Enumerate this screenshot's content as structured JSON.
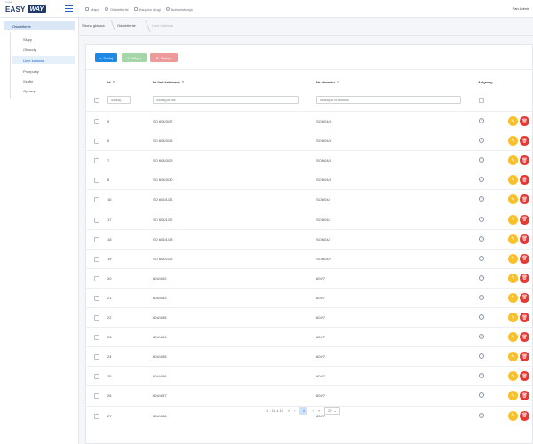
{
  "header": {
    "logo_text": "EASY",
    "logo_badge": "WAY",
    "logo_tagline": "system",
    "nav": [
      {
        "label": "Mapa",
        "icon": "map-icon"
      },
      {
        "label": "Oświetlenie",
        "icon": "lightbulb-icon"
      },
      {
        "label": "Książka drogi",
        "icon": "book-icon"
      },
      {
        "label": "Administracja",
        "icon": "settings-icon"
      }
    ],
    "user": "Pan Admin"
  },
  "sidebar": {
    "section": "Oświetlenie",
    "items": [
      {
        "label": "Słupy"
      },
      {
        "label": "Obwody"
      },
      {
        "label": "Linie kablowe"
      },
      {
        "label": "Przepusty"
      },
      {
        "label": "Szafki"
      },
      {
        "label": "Oprawy"
      }
    ],
    "active_index": 2
  },
  "breadcrumb": [
    "Strona główna",
    "Oświetlenie",
    "Linie kablowe"
  ],
  "toolbar": {
    "add": "Dodaj",
    "enable": "Włącz",
    "disable": "Wyłącz"
  },
  "table": {
    "headers": {
      "id": "Id",
      "cable": "Nr linii kablowej",
      "circuit": "Nr obwodu",
      "active": "Aktywny"
    },
    "filters": {
      "id": "Szukaj...",
      "cable": "Szukaj po linii",
      "circuit": "Szukaj po nr obwodu"
    },
    "rows": [
      {
        "id": "5",
        "cable": "SO 604/3/27",
        "circuit": "SO 604/3"
      },
      {
        "id": "6",
        "cable": "SO 604/3/28",
        "circuit": "SO 604/3"
      },
      {
        "id": "7",
        "cable": "SO 604/3/29",
        "circuit": "SO 604/3"
      },
      {
        "id": "8",
        "cable": "SO 604/3/30",
        "circuit": "SO 604/3"
      },
      {
        "id": "16",
        "cable": "SO 604/1/21",
        "circuit": "SO 604/1"
      },
      {
        "id": "17",
        "cable": "SO 604/1/22",
        "circuit": "SO 604/1"
      },
      {
        "id": "18",
        "cable": "SO 604/1/23",
        "circuit": "SO 604/1"
      },
      {
        "id": "19",
        "cable": "SO 604/2/25",
        "circuit": "SO 604/2"
      },
      {
        "id": "20",
        "cable": "604/4/32",
        "circuit": "604/7"
      },
      {
        "id": "21",
        "cable": "604/4/33",
        "circuit": "604/7"
      },
      {
        "id": "22",
        "cable": "604/4/35",
        "circuit": "604/7"
      },
      {
        "id": "23",
        "cable": "604/4/34",
        "circuit": "604/7"
      },
      {
        "id": "24",
        "cable": "604/4/35",
        "circuit": "604/7"
      },
      {
        "id": "25",
        "cable": "604/4/36",
        "circuit": "604/7"
      },
      {
        "id": "26",
        "cable": "604/4/37",
        "circuit": "604/7"
      },
      {
        "id": "27",
        "cable": "604/4/38",
        "circuit": "604/7"
      }
    ]
  },
  "pagination": {
    "summary": "1 - 16 z 16",
    "page": "1",
    "per_page": "20"
  },
  "colors": {
    "primary": "#1e88e5",
    "success": "#a5d6a7",
    "danger": "#ef9a9a",
    "edit": "#f9c02a",
    "delete": "#e53935"
  }
}
